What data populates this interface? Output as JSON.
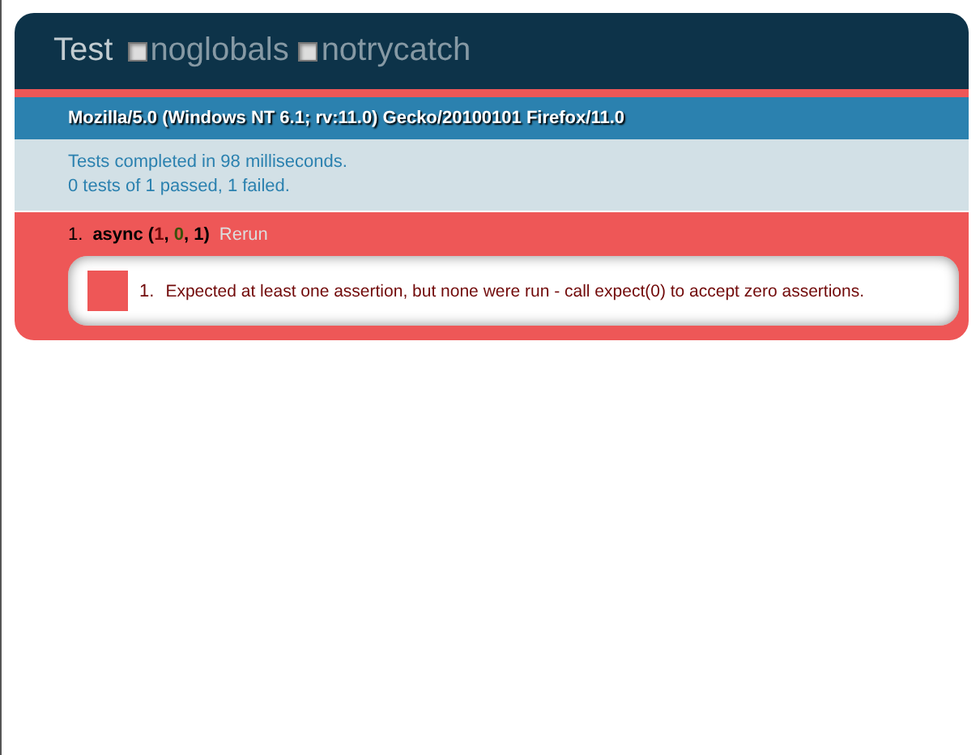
{
  "header": {
    "title": "Test",
    "options": [
      {
        "label": "noglobals",
        "checked": false
      },
      {
        "label": "notrycatch",
        "checked": false
      }
    ]
  },
  "user_agent": "Mozilla/5.0 (Windows NT 6.1; rv:11.0) Gecko/20100101 Firefox/11.0",
  "result_lines": [
    "Tests completed in 98 milliseconds.",
    "0 tests of 1 passed, 1 failed."
  ],
  "tests": [
    {
      "number": "1.",
      "name": "async",
      "open": "(",
      "sep": ", ",
      "close": ")",
      "counts": [
        {
          "kind": "failed",
          "text": "1"
        },
        {
          "kind": "passed",
          "text": "0"
        },
        {
          "kind": "total",
          "text": "1"
        }
      ],
      "rerun": "Rerun",
      "failed": true,
      "assertions": [
        {
          "number": "1.",
          "message": "Expected at least one assertion, but none were run - call expect(0) to accept zero assertions.",
          "failed": true
        }
      ]
    }
  ]
}
